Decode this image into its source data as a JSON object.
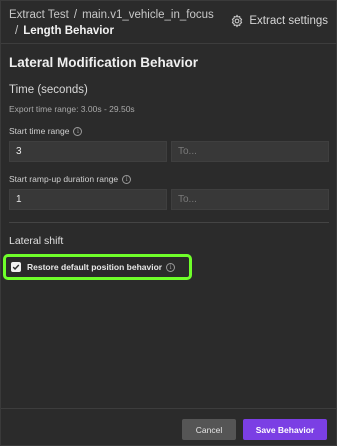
{
  "breadcrumb": {
    "root": "Extract Test",
    "separator": "/",
    "item": "main.v1_vehicle_in_focus",
    "current": "Length Behavior"
  },
  "header": {
    "settings_label": "Extract settings",
    "settings_icon": "gear-icon"
  },
  "section": {
    "title": "Lateral Modification Behavior"
  },
  "time": {
    "title": "Time (seconds)",
    "hint": "Export time range: 3.00s - 29.50s",
    "start_label": "Start time range",
    "start_value": "3",
    "start_to_placeholder": "To...",
    "rampup_label": "Start ramp-up duration range",
    "rampup_value": "1",
    "rampup_to_placeholder": "To..."
  },
  "lateral": {
    "title": "Lateral shift",
    "restore_label": "Restore default position behavior",
    "restore_checked": true
  },
  "footer": {
    "cancel_label": "Cancel",
    "save_label": "Save Behavior"
  },
  "colors": {
    "accent": "#7b3fe4",
    "highlight": "#6fff2a",
    "background": "#2b2b2b"
  }
}
